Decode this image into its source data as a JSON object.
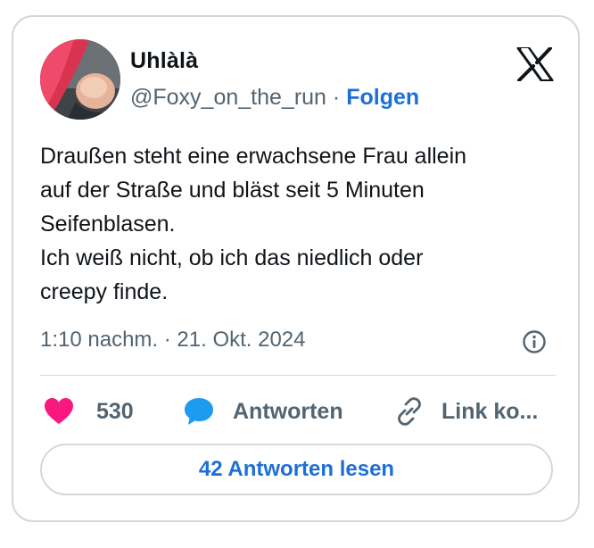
{
  "author": {
    "display_name": "Uhlàlà",
    "handle": "@Foxy_on_the_run",
    "separator": "·",
    "follow_label": "Folgen"
  },
  "tweet": {
    "text": "Draußen steht eine erwachsene Frau allein\nauf der Straße und bläst seit 5 Minuten\nSeifenblasen.\nIch weiß nicht, ob ich das niedlich oder\ncreepy finde.",
    "timestamp": "1:10 nachm. · 21. Okt. 2024"
  },
  "actions": {
    "like_count": "530",
    "reply_label": "Antworten",
    "copy_link_label": "Link ko..."
  },
  "footer": {
    "read_replies_label": "42 Antworten lesen"
  },
  "icons": {
    "logo": "x-logo-icon",
    "info": "info-icon",
    "like": "heart-icon",
    "reply": "speech-bubble-icon",
    "copy": "link-icon"
  },
  "colors": {
    "link_blue": "#1d6fd8",
    "heart": "#f91880",
    "reply_bubble": "#1d9bf0",
    "muted_text": "#536471",
    "border": "#cfd9de"
  }
}
